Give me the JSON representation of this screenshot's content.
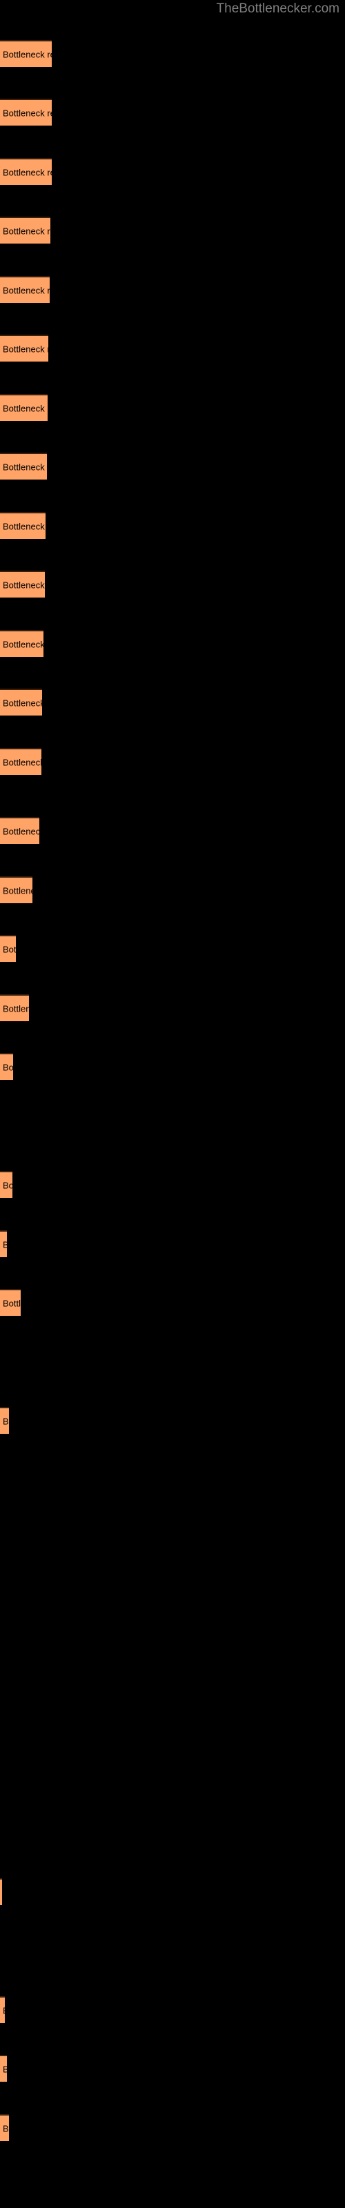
{
  "header": {
    "site_title": "TheBottlenecker.com"
  },
  "colors": {
    "background": "#000000",
    "bar_fill": "#FFA366",
    "bar_border": "#3a1f0d",
    "label_text": "#000000",
    "title_text": "#808080"
  },
  "chart_data": {
    "type": "bar",
    "orientation": "horizontal",
    "title": "",
    "subtitle": "",
    "xlabel": "",
    "ylabel": "",
    "grid": false,
    "legend": null,
    "bar_label_text": "Bottleneck result",
    "xlim": [
      0,
      500
    ],
    "categories": [
      "Bottleneck result",
      "Bottleneck result",
      "Bottleneck result",
      "Bottleneck result",
      "Bottleneck result",
      "Bottleneck result",
      "Bottleneck result",
      "Bottleneck result",
      "Bottleneck result",
      "Bottleneck result",
      "Bottleneck result",
      "Bottleneck result",
      "Bottleneck result",
      "Bottleneck result",
      "Bottleneck result",
      "Bottleneck result",
      "Bottleneck result",
      "Bottleneck result",
      "Bottleneck result",
      "Bottleneck result",
      "Bottleneck result",
      "Bottleneck result",
      "Bottleneck result",
      "Bottleneck result",
      "Bottleneck result",
      "Bottleneck result",
      "Bottleneck result",
      "Bottleneck result",
      "Bottleneck result",
      "Bottleneck result",
      "Bottleneck result",
      "Bottleneck result"
    ],
    "values": [
      75,
      75,
      75,
      73,
      72,
      70,
      69,
      68,
      66,
      65,
      63,
      61,
      60,
      57,
      47,
      23,
      42,
      19,
      0,
      18,
      10,
      30,
      0,
      13,
      0,
      0,
      0,
      3,
      0,
      7,
      10,
      13
    ],
    "bars": [
      {
        "y": 58,
        "height": 39,
        "width": 75,
        "label": "Bottleneck result",
        "visible": true
      },
      {
        "y": 143,
        "height": 39,
        "width": 75,
        "label": "Bottleneck result",
        "visible": true
      },
      {
        "y": 229,
        "height": 39,
        "width": 75,
        "label": "Bottleneck result",
        "visible": true
      },
      {
        "y": 314,
        "height": 39,
        "width": 73,
        "label": "Bottleneck result",
        "visible": true
      },
      {
        "y": 400,
        "height": 39,
        "width": 72,
        "label": "Bottleneck result",
        "visible": true
      },
      {
        "y": 485,
        "height": 39,
        "width": 70,
        "label": "Bottleneck result",
        "visible": true
      },
      {
        "y": 571,
        "height": 39,
        "width": 69,
        "label": "Bottleneck result",
        "visible": true
      },
      {
        "y": 656,
        "height": 39,
        "width": 68,
        "label": "Bottleneck result",
        "visible": true
      },
      {
        "y": 742,
        "height": 39,
        "width": 66,
        "label": "Bottleneck result",
        "visible": true
      },
      {
        "y": 827,
        "height": 39,
        "width": 65,
        "label": "Bottleneck result",
        "visible": true
      },
      {
        "y": 913,
        "height": 39,
        "width": 63,
        "label": "Bottleneck result",
        "visible": true
      },
      {
        "y": 998,
        "height": 39,
        "width": 61,
        "label": "Bottleneck result",
        "visible": true
      },
      {
        "y": 1084,
        "height": 39,
        "width": 60,
        "label": "Bottleneck result",
        "visible": true
      },
      {
        "y": 1184,
        "height": 39,
        "width": 57,
        "label": "Bottleneck result",
        "visible": true
      },
      {
        "y": 1270,
        "height": 39,
        "width": 47,
        "label": "Bottleneck result",
        "visible": true
      },
      {
        "y": 1355,
        "height": 39,
        "width": 23,
        "label": "Bottleneck result",
        "visible": true
      },
      {
        "y": 1441,
        "height": 39,
        "width": 42,
        "label": "Bottleneck result",
        "visible": true
      },
      {
        "y": 1526,
        "height": 39,
        "width": 19,
        "label": "Bottleneck result",
        "visible": true
      },
      {
        "y": 1612,
        "height": 39,
        "width": 0,
        "label": "Bottleneck result",
        "visible": false
      },
      {
        "y": 1697,
        "height": 39,
        "width": 18,
        "label": "Bottleneck result",
        "visible": true
      },
      {
        "y": 1783,
        "height": 39,
        "width": 10,
        "label": "Bottleneck result",
        "visible": true
      },
      {
        "y": 1868,
        "height": 39,
        "width": 30,
        "label": "Bottleneck result",
        "visible": true
      },
      {
        "y": 1954,
        "height": 39,
        "width": 0,
        "label": "Bottleneck result",
        "visible": false
      },
      {
        "y": 2039,
        "height": 39,
        "width": 13,
        "label": "Bottleneck result",
        "visible": true
      },
      {
        "y": 2125,
        "height": 39,
        "width": 0,
        "label": "Bottleneck result",
        "visible": false
      },
      {
        "y": 2210,
        "height": 39,
        "width": 0,
        "label": "Bottleneck result",
        "visible": false
      },
      {
        "y": 2296,
        "height": 39,
        "width": 0,
        "label": "Bottleneck result",
        "visible": false
      },
      {
        "y": 2722,
        "height": 39,
        "width": 3,
        "label": "Bottleneck result",
        "visible": true
      },
      {
        "y": 2807,
        "height": 39,
        "width": 0,
        "label": "Bottleneck result",
        "visible": false
      },
      {
        "y": 2893,
        "height": 39,
        "width": 7,
        "label": "Bottleneck result",
        "visible": true
      },
      {
        "y": 2978,
        "height": 39,
        "width": 10,
        "label": "Bottleneck result",
        "visible": true
      },
      {
        "y": 3064,
        "height": 39,
        "width": 13,
        "label": "Bottleneck result",
        "visible": true
      }
    ]
  }
}
